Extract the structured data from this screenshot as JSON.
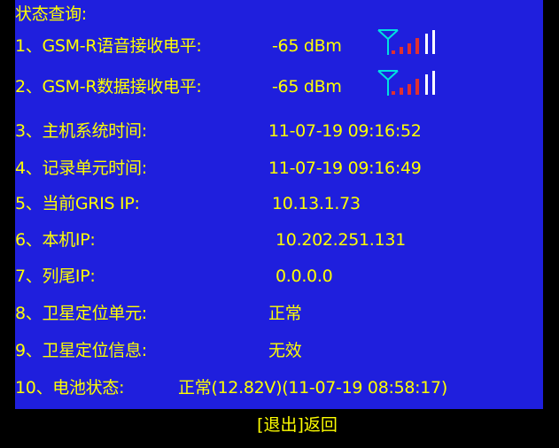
{
  "title": "状态查询:",
  "rows": [
    {
      "label": "1、GSM-R语音接收电平:",
      "value": "-65 dBm"
    },
    {
      "label": "2、GSM-R数据接收电平:",
      "value": "-65 dBm"
    },
    {
      "label": "3、主机系统时间:",
      "value": "11-07-19 09:16:52"
    },
    {
      "label": "4、记录单元时间:",
      "value": "11-07-19 09:16:49"
    },
    {
      "label": "5、当前GRIS IP:",
      "value": "10.13.1.73"
    },
    {
      "label": "6、本机IP:",
      "value": "10.202.251.131"
    },
    {
      "label": "7、列尾IP:",
      "value": "0.0.0.0"
    },
    {
      "label": "8、卫星定位单元:",
      "value": "正常"
    },
    {
      "label": "9、卫星定位信息:",
      "value": "无效"
    },
    {
      "label": "10、电池状态:",
      "value": "正常(12.82V)(11-07-19 08:58:17)"
    }
  ],
  "footer": {
    "exit_label": "[退出]返回"
  },
  "signal_icon": {
    "name": "signal-strength-icon",
    "bars_lit": 4,
    "bars_total": 6
  },
  "colors": {
    "background": "#1f1fdd",
    "outer": "#000000",
    "text": "#ffff00",
    "signal_bars_lit": "#e03030",
    "signal_bars_unlit": "#ffffff",
    "antenna": "#00e0e0"
  }
}
